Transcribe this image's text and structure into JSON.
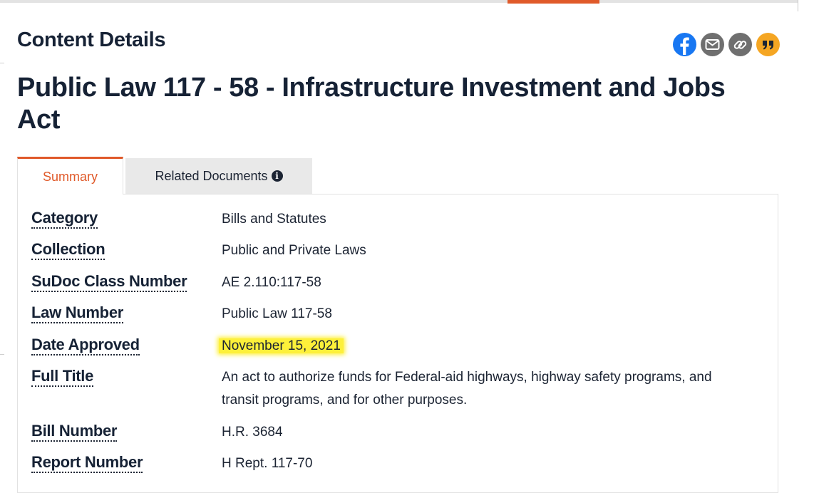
{
  "header": {
    "section_title": "Content Details",
    "page_title": "Public Law 117 - 58 - Infrastructure Investment and Jobs Act"
  },
  "share": [
    {
      "name": "facebook-icon",
      "color": "#1877f2"
    },
    {
      "name": "email-icon",
      "color": "#6f6f6f"
    },
    {
      "name": "link-icon",
      "color": "#6f6f6f"
    },
    {
      "name": "quote-icon",
      "color": "#f5a623"
    }
  ],
  "tabs": {
    "summary_label": "Summary",
    "related_label": "Related Documents",
    "related_info_icon": "info-icon"
  },
  "details": {
    "category": {
      "label": "Category",
      "value": "Bills and Statutes"
    },
    "collection": {
      "label": "Collection",
      "value": "Public and Private Laws"
    },
    "sudoc": {
      "label": "SuDoc Class Number",
      "value": "AE 2.110:117-58"
    },
    "law_number": {
      "label": "Law Number",
      "value": "Public Law 117-58"
    },
    "date_approved": {
      "label": "Date Approved",
      "value": "November 15, 2021"
    },
    "full_title": {
      "label": "Full Title",
      "value": "An act to authorize funds for Federal-aid highways, highway safety programs, and transit programs, and for other purposes."
    },
    "bill_number": {
      "label": "Bill Number",
      "value": "H.R. 3684"
    },
    "report_number": {
      "label": "Report Number",
      "value": "H Rept. 117-70"
    }
  },
  "colors": {
    "accent": "#e05a2a",
    "title": "#162235",
    "highlight": "#fdf03a"
  }
}
